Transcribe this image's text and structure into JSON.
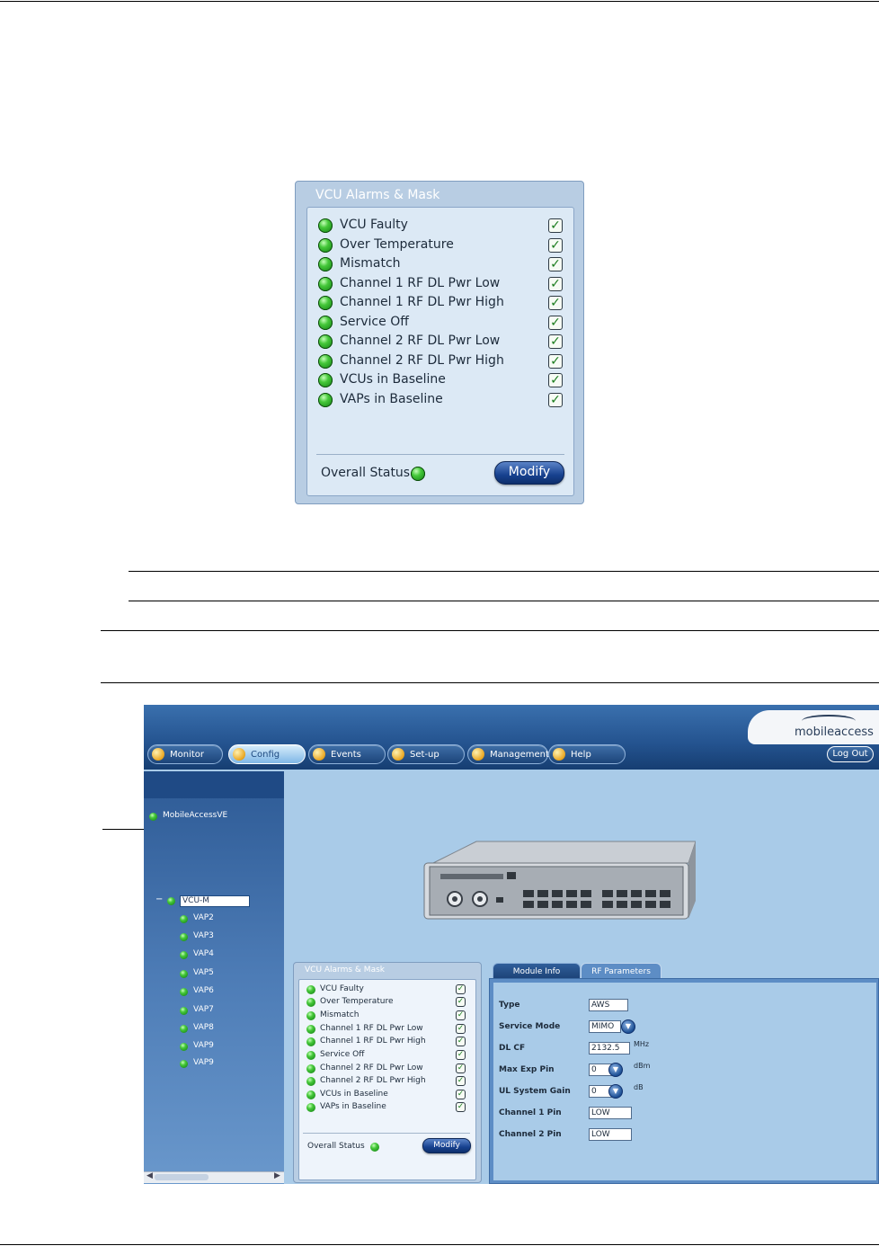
{
  "alarm_panel": {
    "title": "VCU Alarms & Mask",
    "alarms": [
      "VCU Faulty",
      "Over Temperature",
      "Mismatch",
      "Channel 1 RF DL Pwr Low",
      "Channel 1 RF DL Pwr High",
      "Service Off",
      "Channel 2 RF DL Pwr Low",
      "Channel 2 RF DL Pwr High",
      "VCUs in Baseline",
      "VAPs in Baseline"
    ],
    "checkmark": "✓",
    "overall_status_label": "Overall Status",
    "modify_label": "Modify"
  },
  "app": {
    "logo_text": "mobileaccess",
    "nav_tabs": [
      "Monitor",
      "Config",
      "Events",
      "Set-up",
      "Management",
      "Help"
    ],
    "active_tab": "Config",
    "logout_label": "Log Out",
    "tree": {
      "root": "MobileAccessVE",
      "selected": "VCU-M",
      "children": [
        "VAP2",
        "VAP3",
        "VAP4",
        "VAP5",
        "VAP6",
        "VAP7",
        "VAP8",
        "VAP9",
        "VAP9"
      ]
    },
    "tabs": {
      "module_info": "Module Info",
      "rf_parameters": "RF Parameters"
    },
    "rf_params": {
      "type_label": "Type",
      "type_value": "AWS",
      "service_mode_label": "Service Mode",
      "service_mode_value": "MIMO",
      "dl_cf_label": "DL CF",
      "dl_cf_value": "2132.5",
      "dl_cf_unit": "MHz",
      "max_exp_pin_label": "Max Exp Pin",
      "max_exp_pin_value": "0",
      "max_exp_pin_unit": "dBm",
      "ul_gain_label": "UL System Gain",
      "ul_gain_value": "0",
      "ul_gain_unit": "dB",
      "ch1_pin_label": "Channel 1 Pin",
      "ch1_pin_value": "LOW",
      "ch2_pin_label": "Channel 2 Pin",
      "ch2_pin_value": "LOW"
    }
  },
  "colors": {
    "led_green": "#2fb02a",
    "panel_bg": "#b8cde3",
    "header_blue": "#24538f"
  }
}
